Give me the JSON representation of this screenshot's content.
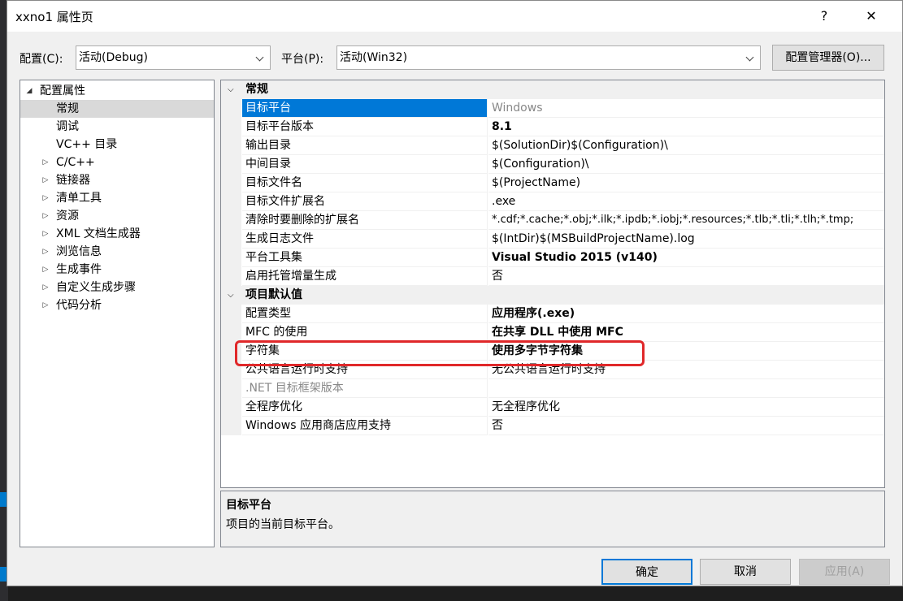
{
  "window": {
    "title": "xxno1 属性页",
    "help": "?",
    "close": "✕"
  },
  "toolbar": {
    "config_label": "配置(C):",
    "config_value": "活动(Debug)",
    "platform_label": "平台(P):",
    "platform_value": "活动(Win32)",
    "manager_button": "配置管理器(O)..."
  },
  "tree": {
    "root": "配置属性",
    "items": [
      {
        "label": "常规",
        "expander": ""
      },
      {
        "label": "调试",
        "expander": ""
      },
      {
        "label": "VC++ 目录",
        "expander": ""
      },
      {
        "label": "C/C++",
        "expander": "▷"
      },
      {
        "label": "链接器",
        "expander": "▷"
      },
      {
        "label": "清单工具",
        "expander": "▷"
      },
      {
        "label": "资源",
        "expander": "▷"
      },
      {
        "label": "XML 文档生成器",
        "expander": "▷"
      },
      {
        "label": "浏览信息",
        "expander": "▷"
      },
      {
        "label": "生成事件",
        "expander": "▷"
      },
      {
        "label": "自定义生成步骤",
        "expander": "▷"
      },
      {
        "label": "代码分析",
        "expander": "▷"
      }
    ]
  },
  "grid": {
    "cat1": "常规",
    "cat1_rows": [
      {
        "name": "目标平台",
        "value": "Windows"
      },
      {
        "name": "目标平台版本",
        "value": "8.1"
      },
      {
        "name": "输出目录",
        "value": "$(SolutionDir)$(Configuration)\\"
      },
      {
        "name": "中间目录",
        "value": "$(Configuration)\\"
      },
      {
        "name": "目标文件名",
        "value": "$(ProjectName)"
      },
      {
        "name": "目标文件扩展名",
        "value": ".exe"
      },
      {
        "name": "清除时要删除的扩展名",
        "value": "*.cdf;*.cache;*.obj;*.ilk;*.ipdb;*.iobj;*.resources;*.tlb;*.tli;*.tlh;*.tmp;"
      },
      {
        "name": "生成日志文件",
        "value": "$(IntDir)$(MSBuildProjectName).log"
      },
      {
        "name": "平台工具集",
        "value": "Visual Studio 2015 (v140)"
      },
      {
        "name": "启用托管增量生成",
        "value": "否"
      }
    ],
    "cat2": "项目默认值",
    "cat2_rows": [
      {
        "name": "配置类型",
        "value": "应用程序(.exe)"
      },
      {
        "name": "MFC 的使用",
        "value": "在共享 DLL 中使用 MFC"
      },
      {
        "name": "字符集",
        "value": "使用多字节字符集"
      },
      {
        "name": "公共语言运行时支持",
        "value": "无公共语言运行时支持"
      },
      {
        "name": ".NET 目标框架版本",
        "value": ""
      },
      {
        "name": "全程序优化",
        "value": "无全程序优化"
      },
      {
        "name": "Windows 应用商店应用支持",
        "value": "否"
      }
    ]
  },
  "description": {
    "title": "目标平台",
    "text": "项目的当前目标平台。"
  },
  "buttons": {
    "ok": "确定",
    "cancel": "取消",
    "apply": "应用(A)"
  },
  "highlight_color": "#e0282a",
  "accent": "#0078d7"
}
